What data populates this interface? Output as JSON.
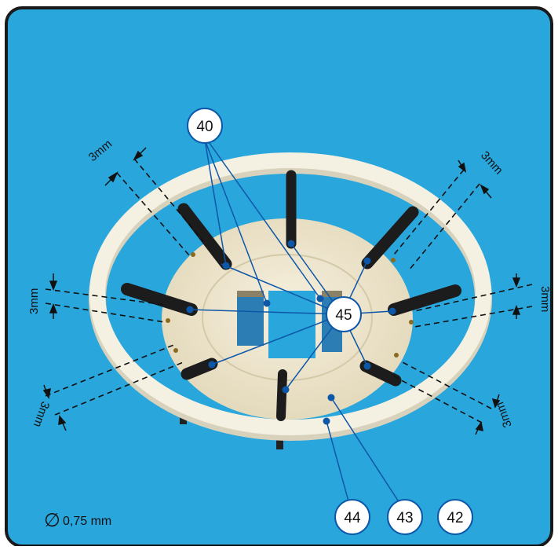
{
  "panel": {
    "background": "#29a6dc",
    "border": "#1a1a1a"
  },
  "callouts": {
    "c40": "40",
    "c45": "45",
    "c44": "44",
    "c43": "43",
    "c42": "42"
  },
  "dimensions": {
    "left_top": "3mm",
    "left_mid": "3mm",
    "left_bottom": "3mm",
    "right_top": "3mm",
    "right_mid": "3mm",
    "right_bottom": "3mm"
  },
  "diameter_note": {
    "symbol": "∅",
    "value": "0,75 mm"
  },
  "colors": {
    "ring": "#f3efe0",
    "ring_shade": "#d9d3bd",
    "base": "#eee6cf",
    "arm": "#1c1c1c",
    "dot": "#0d57a8",
    "hole": "#8a6a1e",
    "leader": "#0d57a8",
    "dim_line": "#111111"
  }
}
